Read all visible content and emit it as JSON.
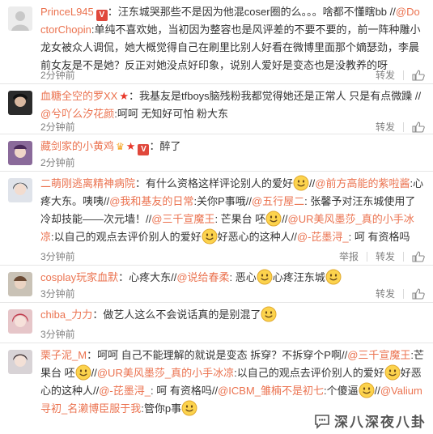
{
  "comments": [
    {
      "user": "PrinceL945",
      "parts": [
        {
          "t": "：汪东城哭那些不是因为他混coser圈的么。。。啥都不懂瞎bb //"
        },
        {
          "m": "@DoctorChopin"
        },
        {
          "t": ":单纯不喜欢她，当初因为整容也是风评差的不要不要的，前一阵种雕小龙女被众人调侃，她大概觉得自己在刷里比别人好看在微博里面那个嫡瑟劲，李晨前女友是不是她？反正对她没点好印象，说别人爱好是变态也是没教养的呀"
        }
      ],
      "time": "2分钟前",
      "actions": [
        "转发"
      ]
    },
    {
      "user": "血糖全空的罗XX",
      "parts": [
        {
          "t": "：我基友是tfboys脑残粉我都觉得她还是正常人 只是有点微躁 //"
        },
        {
          "m": "@兮吖么汐花颜"
        },
        {
          "t": ":呵呵 无知好可怕 粉大东"
        }
      ],
      "time": "2分钟前",
      "actions": [
        "转发"
      ]
    },
    {
      "user": "藏剑家的小黄鸡",
      "parts": [
        {
          "t": "：醉了"
        }
      ],
      "time": "2分钟前",
      "actions": []
    },
    {
      "user": "二萌刚逃离精神病院",
      "parts": [
        {
          "t": "：有什么资格这样评论别人的爱好"
        },
        {
          "e": "smile"
        },
        {
          "t": "//"
        },
        {
          "m": "@前方高能的紫啦酱"
        },
        {
          "t": ":心疼大东。咦咦//"
        },
        {
          "m": "@我和基友的日常"
        },
        {
          "t": ":关你P事哦//"
        },
        {
          "m": "@五行屋二"
        },
        {
          "t": ": 张馨予对汪东城使用了冷却技能——次元墙！//"
        },
        {
          "m": "@三千宣魔王"
        },
        {
          "t": ": 芒果台 呸"
        },
        {
          "e": "smile"
        },
        {
          "t": "//"
        },
        {
          "m": "@UR美风墨莎_真的小手冰凉"
        },
        {
          "t": ":以自己的观点去评价别人的爱好"
        },
        {
          "e": "smile"
        },
        {
          "t": "好恶心的这种人//"
        },
        {
          "m": "@-芘墨浔_"
        },
        {
          "t": ": 呵 有资格吗"
        }
      ],
      "time": "3分钟前",
      "actions": [
        "举报",
        "转发"
      ]
    },
    {
      "user": "cosplay玩家血默",
      "parts": [
        {
          "t": "：心疼大东//"
        },
        {
          "m": "@说给春柔"
        },
        {
          "t": ": 恶心"
        },
        {
          "e": "smile"
        },
        {
          "t": "心疼汪东城"
        },
        {
          "e": "smile"
        }
      ],
      "time": "3分钟前",
      "actions": [
        "转发"
      ]
    },
    {
      "user": "chiba_力力",
      "parts": [
        {
          "t": "：做艺人这么不会说话真的是别混了"
        },
        {
          "e": "smile"
        }
      ],
      "time": "3分钟前",
      "actions": []
    },
    {
      "user": "栗子泥_M",
      "parts": [
        {
          "t": "：呵呵 自己不能理解的就说是变态 拆穿？不拆穿个P啊//"
        },
        {
          "m": "@三千宣魔王"
        },
        {
          "t": ":芒果台 呸"
        },
        {
          "e": "smile"
        },
        {
          "t": "//"
        },
        {
          "m": "@UR美风墨莎_真的小手冰凉"
        },
        {
          "t": ":以自己的观点去评价别人的爱好"
        },
        {
          "e": "smile"
        },
        {
          "t": "好恶心的这种人//"
        },
        {
          "m": "@-芘墨浔_"
        },
        {
          "t": ": 呵 有资格吗//"
        },
        {
          "m": "@ICBM_雏楠不是初七"
        },
        {
          "t": ":个傻逼"
        },
        {
          "e": "smile"
        },
        {
          "t": "//"
        },
        {
          "m": "@Valium寻初_名濑博臣服于我"
        },
        {
          "t": ":管你p事"
        },
        {
          "e": "smile"
        }
      ],
      "time": "",
      "actions": []
    }
  ],
  "watermark": {
    "text": "深八深夜八卦"
  },
  "colors": {
    "accent": "#eb7350",
    "muted": "#808080",
    "divider": "#e6e6e6"
  }
}
